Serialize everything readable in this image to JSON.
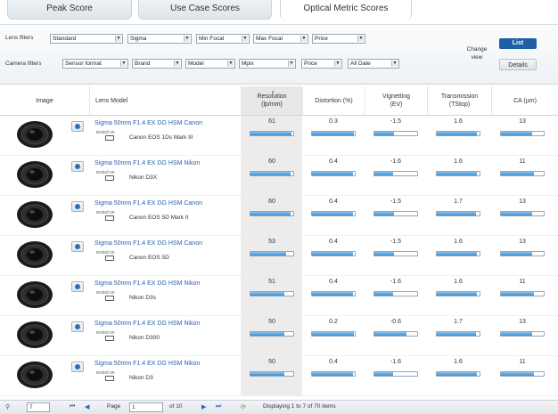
{
  "tabs": [
    {
      "label": "Peak Score"
    },
    {
      "label": "Use Case Scores"
    },
    {
      "label": "Optical Metric Scores"
    }
  ],
  "filters": {
    "lens_label": "Lens filters",
    "camera_label": "Camera filters",
    "lens": [
      "Standard",
      "Sigma",
      "Min Focal",
      "Max Focal",
      "Price"
    ],
    "camera": [
      "Sensor format",
      "Brand",
      "Model",
      "Mpix",
      "Price",
      "All Date"
    ],
    "change_view": "Change view",
    "list_button": "List",
    "details_button": "Details"
  },
  "columns": {
    "image": "Image",
    "model": "Lens Model",
    "resolution": "Resolution (lp/mm)",
    "distortion": "Distortion (%)",
    "vignetting": "Vignetting (EV)",
    "transmission": "Transmission (TStop)",
    "ca": "CA (µm)",
    "sort_marker": "▾"
  },
  "tested_on_label": "tested on",
  "rows": [
    {
      "lens": "Sigma 50mm F1.4 EX DG HSM Canon",
      "camera": "Canon EOS 1Ds Mark III",
      "resolution": "61",
      "distortion": "0.3",
      "vignetting": "-1.5",
      "transmission": "1.6",
      "ca": "13",
      "bars": {
        "resolution": 0.95,
        "distortion": 0.97,
        "vignetting": 0.45,
        "transmission": 0.93,
        "ca": 0.72
      }
    },
    {
      "lens": "Sigma 50mm F1.4 EX DG HSM Nikon",
      "camera": "Nikon D3X",
      "resolution": "60",
      "distortion": "0.4",
      "vignetting": "-1.6",
      "transmission": "1.6",
      "ca": "11",
      "bars": {
        "resolution": 0.94,
        "distortion": 0.96,
        "vignetting": 0.43,
        "transmission": 0.93,
        "ca": 0.78
      }
    },
    {
      "lens": "Sigma 50mm F1.4 EX DG HSM Canon",
      "camera": "Canon EOS 5D Mark II",
      "resolution": "60",
      "distortion": "0.4",
      "vignetting": "-1.5",
      "transmission": "1.7",
      "ca": "13",
      "bars": {
        "resolution": 0.94,
        "distortion": 0.96,
        "vignetting": 0.45,
        "transmission": 0.92,
        "ca": 0.72
      }
    },
    {
      "lens": "Sigma 50mm F1.4 EX DG HSM Canon",
      "camera": "Canon EOS 5D",
      "resolution": "53",
      "distortion": "0.4",
      "vignetting": "-1.5",
      "transmission": "1.6",
      "ca": "13",
      "bars": {
        "resolution": 0.84,
        "distortion": 0.96,
        "vignetting": 0.45,
        "transmission": 0.93,
        "ca": 0.72
      }
    },
    {
      "lens": "Sigma 50mm F1.4 EX DG HSM Nikon",
      "camera": "Nikon D3s",
      "resolution": "51",
      "distortion": "0.4",
      "vignetting": "-1.6",
      "transmission": "1.6",
      "ca": "11",
      "bars": {
        "resolution": 0.8,
        "distortion": 0.96,
        "vignetting": 0.43,
        "transmission": 0.93,
        "ca": 0.78
      }
    },
    {
      "lens": "Sigma 50mm F1.4 EX DG HSM Nikon",
      "camera": "Nikon D300",
      "resolution": "50",
      "distortion": "0.2",
      "vignetting": "-0.6",
      "transmission": "1.7",
      "ca": "13",
      "bars": {
        "resolution": 0.79,
        "distortion": 0.98,
        "vignetting": 0.75,
        "transmission": 0.92,
        "ca": 0.72
      }
    },
    {
      "lens": "Sigma 50mm F1.4 EX DG HSM Nikon",
      "camera": "Nikon D3",
      "resolution": "50",
      "distortion": "0.4",
      "vignetting": "-1.6",
      "transmission": "1.6",
      "ca": "11",
      "bars": {
        "resolution": 0.79,
        "distortion": 0.96,
        "vignetting": 0.43,
        "transmission": 0.93,
        "ca": 0.78
      }
    }
  ],
  "pager": {
    "per_page": "7",
    "page_label": "Page",
    "page_value": "1",
    "of_label": "of 10",
    "status": "Displaying 1 to 7 of 70 items"
  }
}
